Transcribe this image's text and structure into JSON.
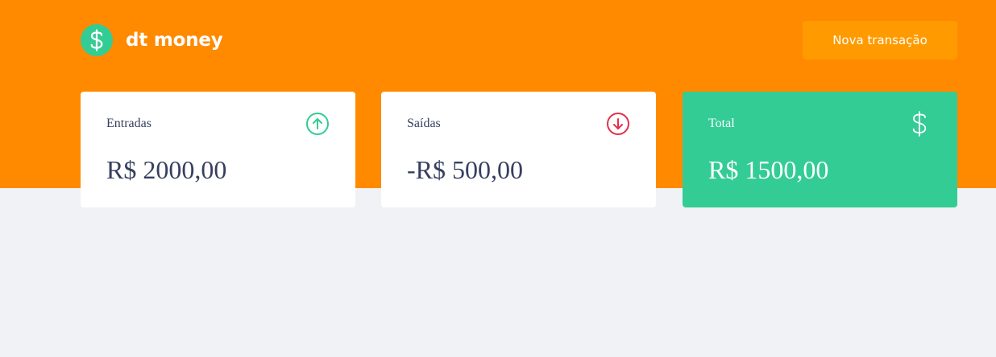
{
  "header": {
    "brand": "dt money",
    "new_transaction_label": "Nova transação",
    "logo_icon": "dollar-sign-icon",
    "background_color": "#ff8a00"
  },
  "summary": {
    "income": {
      "label": "Entradas",
      "value": "R$ 2000,00",
      "icon": "arrow-up-circle-icon",
      "icon_color": "#33cc95"
    },
    "outcome": {
      "label": "Saídas",
      "value": "-R$ 500,00",
      "icon": "arrow-down-circle-icon",
      "icon_color": "#e52e4d"
    },
    "total": {
      "label": "Total",
      "value": "R$ 1500,00",
      "icon": "dollar-sign-icon",
      "background_color": "#33cc95"
    }
  }
}
